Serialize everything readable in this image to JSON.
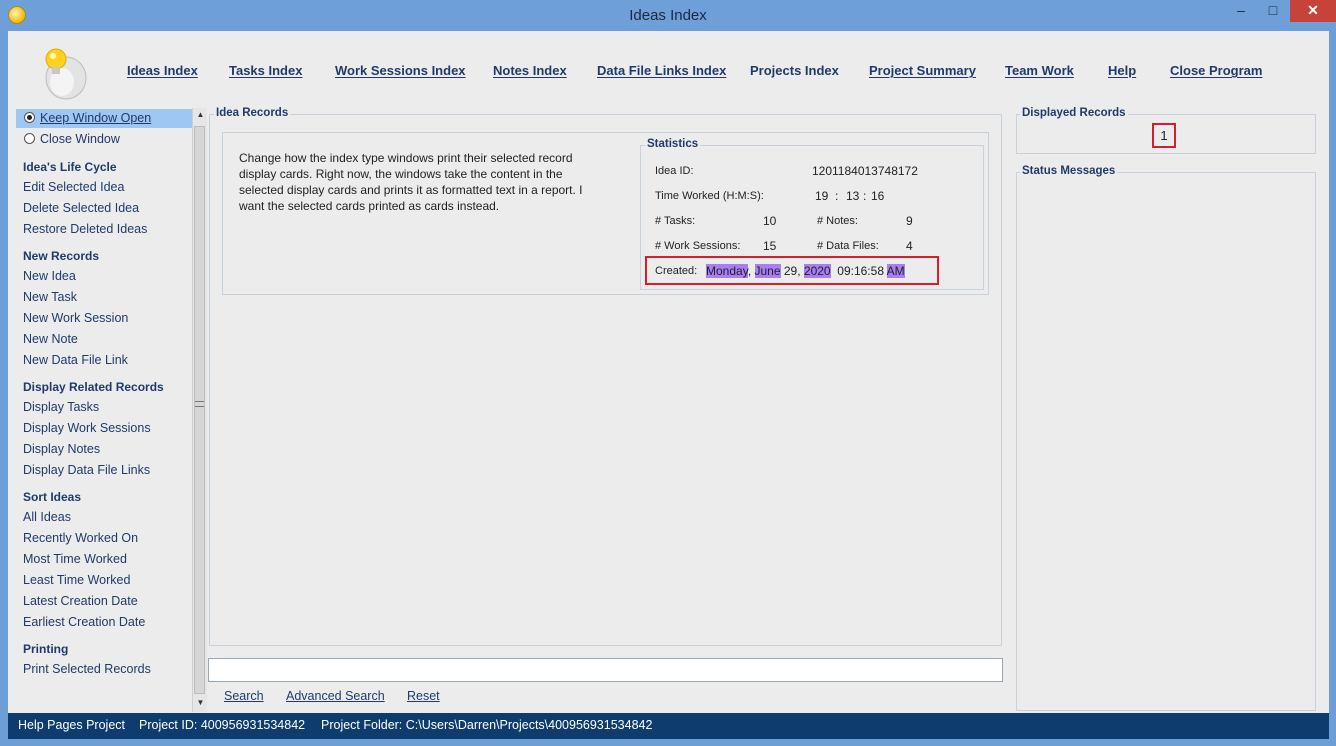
{
  "window": {
    "title": "Ideas Index",
    "minimize": "–",
    "maximize": "□",
    "close": "✕"
  },
  "nav": [
    "Ideas Index",
    "Tasks Index",
    "Work Sessions Index",
    "Notes Index",
    "Data File Links Index",
    "Projects Index",
    "Project Summary",
    "Team Work",
    "Help",
    "Close Program"
  ],
  "sidebar": {
    "keep_open": "Keep Window Open",
    "close_window": "Close Window",
    "lifecycle_head": "Idea's Life Cycle",
    "lifecycle": [
      "Edit Selected Idea",
      "Delete Selected Idea",
      "Restore Deleted Ideas"
    ],
    "new_head": "New Records",
    "new": [
      "New Idea",
      "New Task",
      "New Work Session",
      "New Note",
      "New Data File Link"
    ],
    "display_head": "Display Related Records",
    "display": [
      "Display Tasks",
      "Display Work Sessions",
      "Display Notes",
      "Display Data File Links"
    ],
    "sort_head": "Sort Ideas",
    "sort": [
      "All Ideas",
      "Recently Worked On",
      "Most Time Worked",
      "Least Time Worked",
      "Latest Creation Date",
      "Earliest Creation Date"
    ],
    "print_head": "Printing",
    "print": [
      "Print Selected Records"
    ]
  },
  "records": {
    "title": "Idea Records",
    "description": "Change how the index type windows print their selected record display cards. Right now, the windows take the content in the selected display cards and prints it as formatted text in a report. I want the selected cards printed as cards instead.",
    "statistics_title": "Statistics",
    "idea_id_label": "Idea ID:",
    "idea_id": "1201184013748172",
    "time_label": "Time Worked (H:M:S):",
    "time_h": "19",
    "time_m": "13",
    "time_s": "16",
    "time_sep": ":",
    "tasks_label": "# Tasks:",
    "tasks": "10",
    "notes_label": "# Notes:",
    "notes": "9",
    "sessions_label": "# Work Sessions:",
    "sessions": "15",
    "files_label": "# Data Files:",
    "files": "4",
    "created_label": "Created:",
    "created_weekday": "Monday",
    "created_comma1": ",",
    "created_month": "June",
    "created_day": "29,",
    "created_year": "2020",
    "created_time": "09:16:58",
    "created_ampm": "AM"
  },
  "displayed": {
    "title": "Displayed Records",
    "count": "1"
  },
  "status_messages": {
    "title": "Status Messages"
  },
  "search": {
    "value": "",
    "search_label": "Search",
    "advanced_label": "Advanced Search",
    "reset_label": "Reset"
  },
  "statusbar": {
    "project": "Help Pages Project",
    "project_id": "Project ID:  400956931534842",
    "folder": "Project Folder: C:\\Users\\Darren\\Projects\\400956931534842"
  },
  "colors": {
    "highlight": "#a97df4",
    "callout_border": "#d51f2a",
    "statusbar": "#0e3c6f",
    "selection": "#9ec8f3"
  }
}
